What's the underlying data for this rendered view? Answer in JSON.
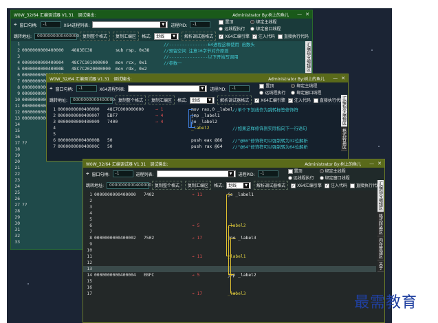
{
  "app": {
    "title": "W0W_32/64 汇编调试器 V1.31",
    "menu": "调试输出:",
    "user": "Administrator  By:树上的鱼儿",
    "ctl_min": "—",
    "ctl_close": "✕"
  },
  "toolbar": {
    "window_handle_label": "窗口句柄:",
    "window_handle_value": "-1",
    "process_list_label": "X64进程列表:",
    "process_list_label_2": "进程列表:",
    "pid_label": "进程PID:",
    "pid_value": "-1",
    "opt_set_top": "置顶",
    "opt_remote": "远线程执行",
    "opt_main": "绑定主线程",
    "opt_fixed_remote": "绑定主线程",
    "opt_window": "绑定窗口线程",
    "opt_fixed_window": "绑定窗口线程",
    "jump_addr_label": "跳转地址:",
    "jump_addr_value": "0000000000400000",
    "copy_format_btn": "复制整个格式",
    "copy_asm_btn": "复制汇编区",
    "mode_label": "格式:",
    "mode_value": "划线",
    "parse_btn": "解析调试器格式",
    "x64_chk": "X64汇编引擎",
    "inject_chk": "注入代码",
    "direct_chk": "直接执行代码"
  },
  "side_tabs": [
    "汇编指令编辑区",
    "格式转换区",
    "内存管理区",
    "关于"
  ],
  "win1": {
    "rows": [
      {
        "n": "1",
        "addr": "",
        "hex": "",
        "code": "",
        "cmt": "//---------------64进程这样使用 函数头"
      },
      {
        "n": "2",
        "addr": "0000000000400000",
        "hex": "4883EC38",
        "code": "sub rsp, 0x38",
        "cmt": "//预留空间 注意16字节对齐原则"
      },
      {
        "n": "3",
        "addr": "",
        "hex": "",
        "code": "",
        "cmt": "//---------------以下开始写调用"
      },
      {
        "n": "4",
        "addr": "0000000000400004",
        "hex": "48C7C101000000",
        "code": "mov rcx, 0x1",
        "cmt": "//参数一"
      },
      {
        "n": "5",
        "addr": "000000000040000B",
        "hex": "48C7C2020000000",
        "code": "mov rdx, 0x2",
        "cmt": ""
      },
      {
        "n": "6",
        "addr": "0000000000400012",
        "hex": "",
        "code": "",
        "cmt": ""
      },
      {
        "n": "7",
        "addr": "0000000000400019",
        "hex": "",
        "code": "",
        "cmt": ""
      },
      {
        "n": "8",
        "addr": "0000000000400020",
        "hex": "",
        "code": "",
        "cmt": ""
      },
      {
        "n": "9",
        "addr": "0000000000400027",
        "hex": "",
        "code": "",
        "cmt": ""
      },
      {
        "n": "10",
        "addr": "000000000040002E",
        "hex": "",
        "code": "",
        "cmt": ""
      },
      {
        "n": "11",
        "addr": "000000000040003B",
        "hex": "",
        "code": "",
        "cmt": ""
      },
      {
        "n": "12",
        "addr": "000000000040003E",
        "hex": "",
        "code": "",
        "cmt": ""
      },
      {
        "n": "13",
        "addr": "0000000000400045",
        "hex": "",
        "code": "",
        "cmt": ""
      },
      {
        "n": "14",
        "addr": "",
        "hex": "",
        "code": "",
        "cmt": ""
      },
      {
        "n": "15",
        "addr": "",
        "hex": "",
        "code": "",
        "cmt": ""
      },
      {
        "n": "16",
        "addr": "",
        "hex": "",
        "code": "",
        "cmt": ""
      },
      {
        "n": "17",
        "addr": "??",
        "hex": "",
        "code": "",
        "cmt": ""
      },
      {
        "n": "18",
        "addr": "",
        "hex": "",
        "code": "",
        "cmt": ""
      },
      {
        "n": "19",
        "addr": "",
        "hex": "",
        "code": "",
        "cmt": ""
      },
      {
        "n": "20",
        "addr": "",
        "hex": "",
        "code": "",
        "cmt": ""
      },
      {
        "n": "21",
        "addr": "",
        "hex": "",
        "code": "",
        "cmt": ""
      },
      {
        "n": "22",
        "addr": "",
        "hex": "",
        "code": "",
        "cmt": ""
      },
      {
        "n": "23",
        "addr": "",
        "hex": "",
        "code": "",
        "cmt": ""
      },
      {
        "n": "24",
        "addr": "",
        "hex": "",
        "code": "",
        "cmt": ""
      },
      {
        "n": "25",
        "addr": "",
        "hex": "",
        "code": "",
        "cmt": ""
      },
      {
        "n": "26",
        "addr": "",
        "hex": "",
        "code": "",
        "cmt": ""
      },
      {
        "n": "27",
        "addr": "??",
        "hex": "",
        "code": "",
        "cmt": ""
      },
      {
        "n": "28",
        "addr": "",
        "hex": "",
        "code": "",
        "cmt": ""
      },
      {
        "n": "29",
        "addr": "",
        "hex": "",
        "code": "",
        "cmt": ""
      },
      {
        "n": "30",
        "addr": "",
        "hex": "",
        "code": "",
        "cmt": ""
      },
      {
        "n": "31",
        "addr": "",
        "hex": "",
        "code": "",
        "cmt": ""
      },
      {
        "n": "32",
        "addr": "",
        "hex": "",
        "code": "",
        "cmt": ""
      },
      {
        "n": "33",
        "addr": "",
        "hex": "",
        "code": "",
        "cmt": ""
      }
    ]
  },
  "win2": {
    "rows": [
      {
        "n": "1",
        "addr": "0000000000400000",
        "hex": "48C7C000000000",
        "arrow": "→ 1",
        "code": "mov rax,0 _label",
        "cmt": "//单个下划线作为跳转标签修饰符"
      },
      {
        "n": "2",
        "addr": "0000000000400007",
        "hex": "EBF7",
        "arrow": "→ 4",
        "code": "jmp _label1",
        "cmt": ""
      },
      {
        "n": "3",
        "addr": "0000000000400009",
        "hex": "7400",
        "arrow": "→ 4",
        "code": "je _label2",
        "cmt": ""
      },
      {
        "n": "4",
        "addr": "",
        "hex": "",
        "arrow": "",
        "code": "_label2",
        "cmt": "//如果这样修饰则实际指向下一行语句"
      },
      {
        "n": "5",
        "addr": "",
        "hex": "",
        "arrow": "",
        "code": "",
        "cmt": ""
      },
      {
        "n": "6",
        "addr": "000000000040000B",
        "hex": "50",
        "arrow": "",
        "code": "push eax @86",
        "cmt": "//\"@86\"修饰符可以强制转为32位解析"
      },
      {
        "n": "7",
        "addr": "000000000040000C",
        "hex": "50",
        "arrow": "",
        "code": "push rax @64",
        "cmt": "//\"@64\"修饰符可以强制转为64位解析"
      }
    ]
  },
  "win3": {
    "rows": [
      {
        "n": "1",
        "addr": "0000000000400000",
        "hex": "7402",
        "arrow": "→ 11",
        "code": "je _label1"
      },
      {
        "n": "2",
        "addr": "",
        "hex": "",
        "arrow": "",
        "code": ""
      },
      {
        "n": "3",
        "addr": "",
        "hex": "",
        "arrow": "",
        "code": ""
      },
      {
        "n": "4",
        "addr": "",
        "hex": "",
        "arrow": "",
        "code": ""
      },
      {
        "n": "5",
        "addr": "",
        "hex": "",
        "arrow": "",
        "code": ""
      },
      {
        "n": "6",
        "addr": "",
        "hex": "",
        "arrow": "→ 5",
        "code": "_label2"
      },
      {
        "n": "7",
        "addr": "",
        "hex": "",
        "arrow": "",
        "code": ""
      },
      {
        "n": "8",
        "addr": "0000000000400002",
        "hex": "7502",
        "arrow": "→ 17",
        "code": "jne _label3"
      },
      {
        "n": "9",
        "addr": "",
        "hex": "",
        "arrow": "",
        "code": ""
      },
      {
        "n": "10",
        "addr": "",
        "hex": "",
        "arrow": "",
        "code": ""
      },
      {
        "n": "11",
        "addr": "",
        "hex": "",
        "arrow": "→ 11",
        "code": "_label1"
      },
      {
        "n": "12",
        "addr": "",
        "hex": "",
        "arrow": "",
        "code": ""
      },
      {
        "n": "13",
        "addr": "",
        "hex": "",
        "arrow": "",
        "code": ""
      },
      {
        "n": "14",
        "addr": "0000000000400004",
        "hex": "EBFC",
        "arrow": "→ 5",
        "code": "jmp _label2"
      },
      {
        "n": "15",
        "addr": "",
        "hex": "",
        "arrow": "",
        "code": ""
      },
      {
        "n": "16",
        "addr": "",
        "hex": "",
        "arrow": "",
        "code": ""
      },
      {
        "n": "17",
        "addr": "",
        "hex": "",
        "arrow": "→ 17",
        "code": "_label3"
      }
    ]
  },
  "watermark": "最需教育",
  "colors": {
    "titlebar_green": "#1a5a1a",
    "titlebar_olive": "#5a6a1a",
    "bg_dark": "#1e2a2a",
    "comment_cyan": "#40c8d0",
    "label_yellow": "#e0c030",
    "watermark_blue": "#2040a0"
  }
}
